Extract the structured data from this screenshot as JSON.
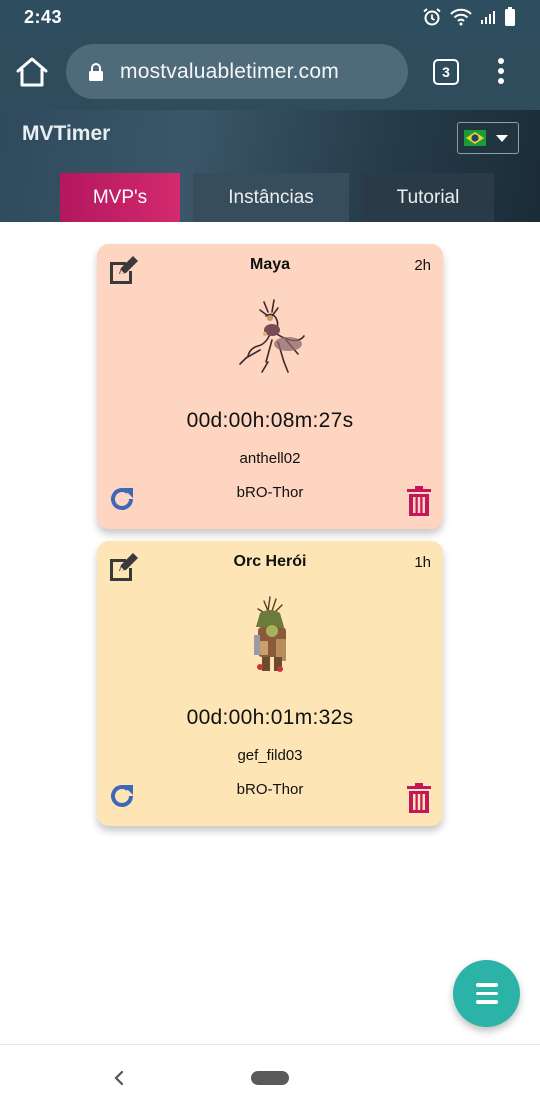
{
  "status_bar": {
    "time": "2:43",
    "icons": [
      "alarm-icon",
      "wifi-icon",
      "signal-icon",
      "battery-icon"
    ]
  },
  "browser": {
    "url": "mostvaluabletimer.com",
    "tab_count": "3",
    "icons": [
      "home-icon",
      "lock-icon",
      "kebab-menu-icon"
    ]
  },
  "app": {
    "title": "MVTimer",
    "language_flag": "brazil-flag-icon",
    "tabs": [
      {
        "label": "MVP's",
        "active": true
      },
      {
        "label": "Instâncias",
        "active": false
      },
      {
        "label": "Tutorial",
        "active": false
      }
    ],
    "accent_color": "#c41f66"
  },
  "cards": [
    {
      "name": "Maya",
      "respawn": "2h",
      "timer": "00d:00h:08m:27s",
      "map": "anthell02",
      "server": "bRO-Thor",
      "background": "#fdd5c1"
    },
    {
      "name": "Orc Herói",
      "respawn": "1h",
      "timer": "00d:00h:01m:32s",
      "map": "gef_fild03",
      "server": "bRO-Thor",
      "background": "#fde5b6"
    }
  ],
  "fab": {
    "icon": "menu-icon",
    "color": "#2bb3a7"
  },
  "system_nav": {
    "icons": [
      "back-icon",
      "home-pill"
    ]
  }
}
